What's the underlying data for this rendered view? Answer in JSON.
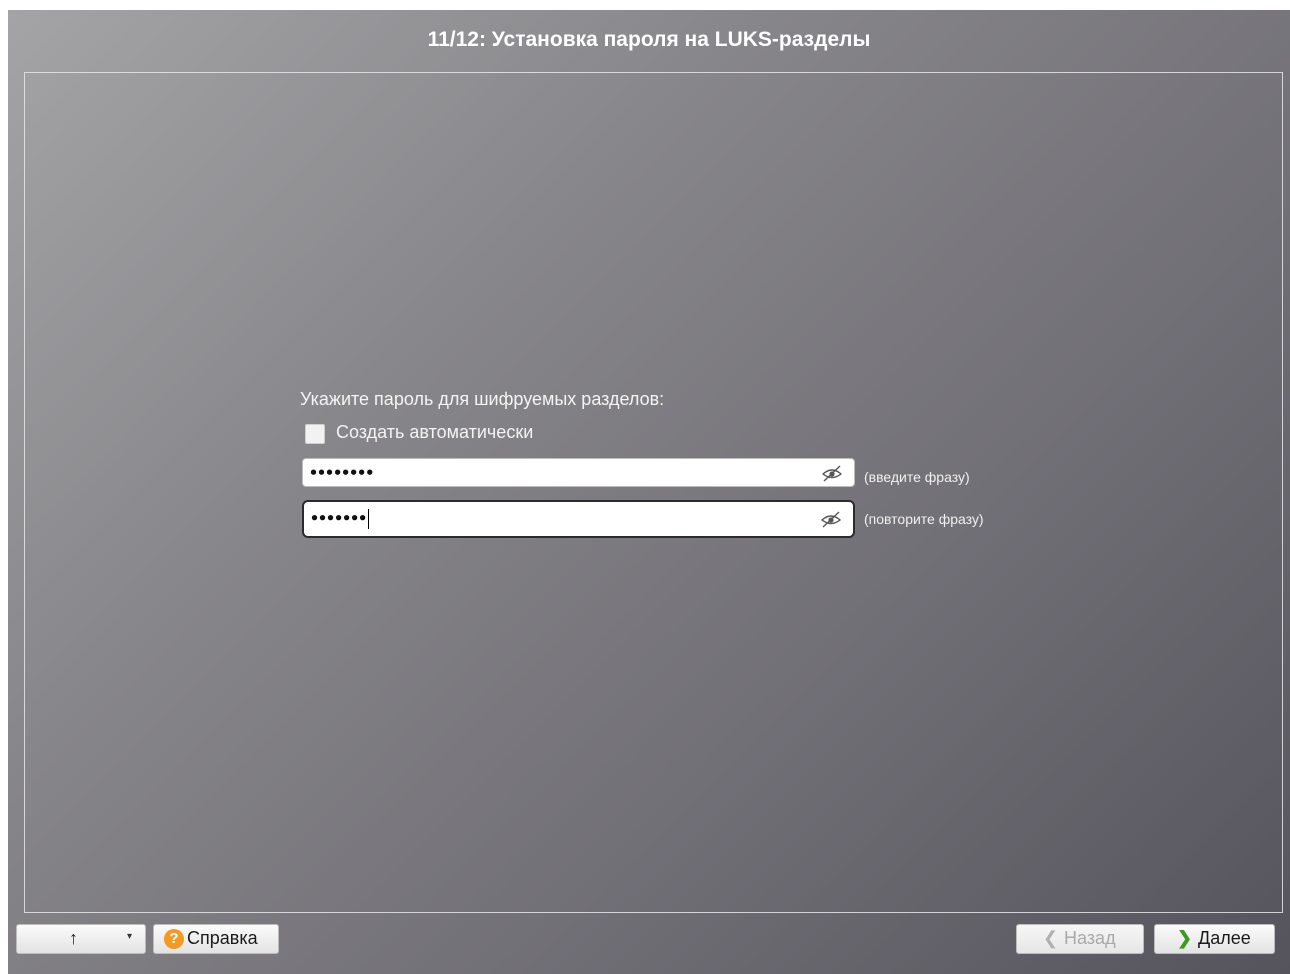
{
  "header": {
    "title": "11/12: Установка пароля на LUKS-разделы"
  },
  "form": {
    "prompt": "Укажите пароль для шифруемых разделов:",
    "auto_create": {
      "label": "Создать автоматически",
      "checked": false
    },
    "passphrase": {
      "value": "••••••••",
      "hint": "(введите фразу)",
      "icon": "eye-slash-icon"
    },
    "passphrase_confirm": {
      "value": "•••••••",
      "hint": "(повторите фразу)",
      "icon": "eye-slash-icon",
      "focused": true
    }
  },
  "footer": {
    "up_icon": "↑",
    "dropdown_icon": "▾",
    "help_icon": "?",
    "help_label": "Справка",
    "back_arrow": "❮",
    "back_label": "Назад",
    "back_enabled": false,
    "next_arrow": "❯",
    "next_label": "Далее"
  },
  "colors": {
    "help_icon_bg": "#f39a24",
    "next_arrow": "#3b9a1f"
  }
}
